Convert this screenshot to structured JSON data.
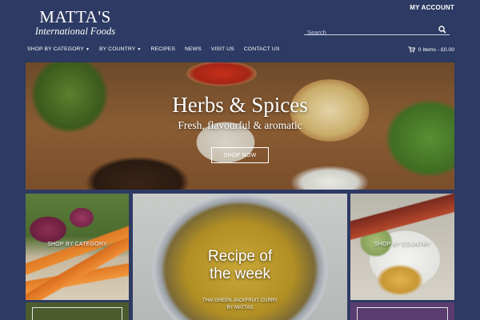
{
  "brand": {
    "name": "MATTA'S",
    "tagline": "International Foods"
  },
  "header": {
    "account_label": "MY ACCOUNT"
  },
  "search": {
    "placeholder": "Search",
    "value": ""
  },
  "nav": {
    "items": [
      {
        "label": "SHOP BY CATEGORY",
        "has_caret": true
      },
      {
        "label": "BY COUNTRY",
        "has_caret": true
      },
      {
        "label": "RECIPES",
        "has_caret": false
      },
      {
        "label": "NEWS",
        "has_caret": false
      },
      {
        "label": "VISIT US",
        "has_caret": false
      },
      {
        "label": "CONTACT US",
        "has_caret": false
      }
    ],
    "cart_label": "0 Items - £0.00"
  },
  "hero": {
    "title": "Herbs & Spices",
    "subtitle": "Fresh, flavourful & aromatic",
    "button_label": "SHOP NOW"
  },
  "tiles": {
    "category_label": "SHOP BY CATEGORY",
    "recipe_title": "Recipe of\nthe week",
    "recipe_subtitle": "THAI GREEN JACKFRUIT CURRY\nBY MATTAS",
    "country_label": "SHOP BY COUNTRY"
  },
  "colors": {
    "background": "#2d3a63",
    "text": "#ffffff"
  },
  "icons": {
    "search": "search-icon",
    "cart": "cart-icon",
    "caret": "chevron-down-icon"
  }
}
